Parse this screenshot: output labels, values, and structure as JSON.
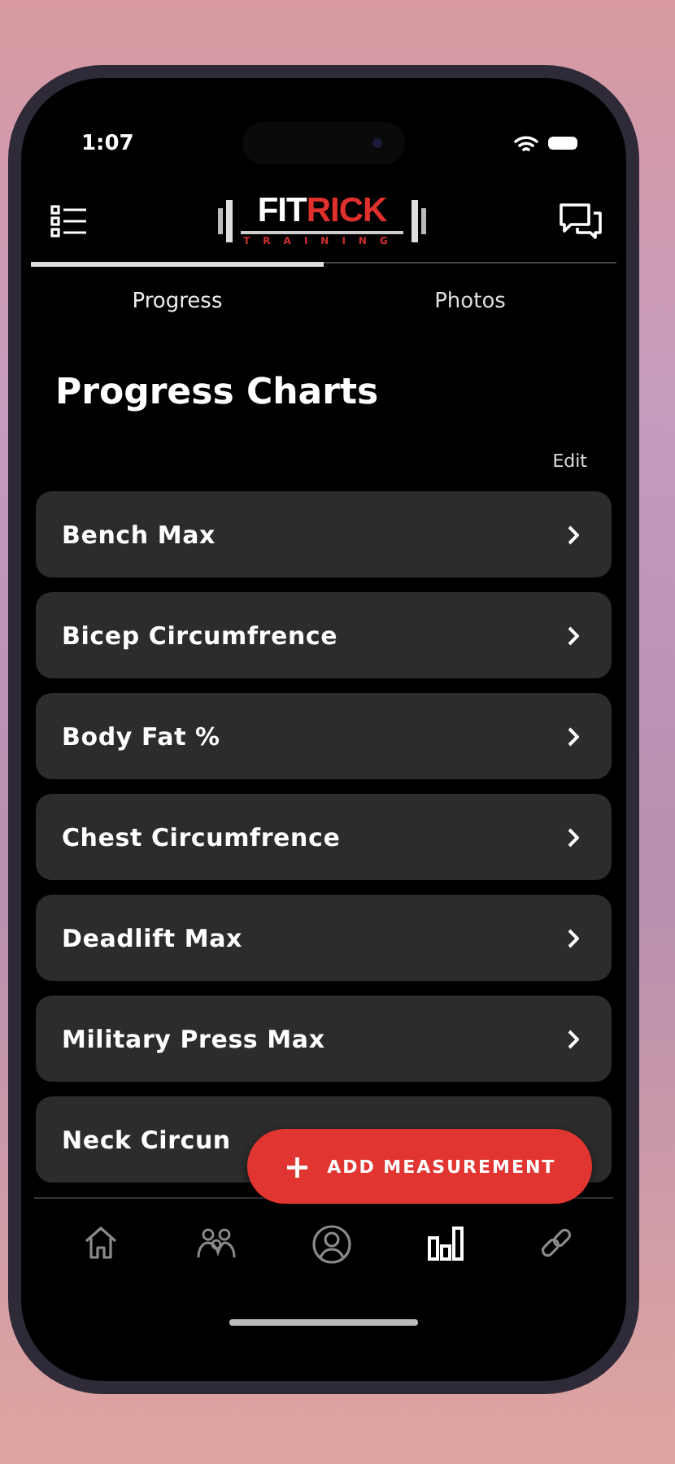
{
  "status_bar": {
    "time": "1:07"
  },
  "header": {
    "logo": {
      "part_1": "FIT",
      "part_2": "RICK",
      "subtitle": "TRAINING"
    }
  },
  "tabs": [
    {
      "label": "Progress",
      "selected": true
    },
    {
      "label": "Photos",
      "selected": false
    }
  ],
  "title": "Progress Charts",
  "edit_link": "Edit",
  "charts": [
    {
      "label": "Bench Max",
      "chevron": true
    },
    {
      "label": "Bicep Circumfrence",
      "chevron": true
    },
    {
      "label": "Body Fat %",
      "chevron": true
    },
    {
      "label": "Chest Circumfrence",
      "chevron": true
    },
    {
      "label": "Deadlift Max",
      "chevron": true
    },
    {
      "label": "Military Press Max",
      "chevron": true
    },
    {
      "label": "Neck Circun",
      "chevron": false
    }
  ],
  "fab": {
    "icon": "+",
    "label": "ADD MEASUREMENT"
  },
  "bottom_nav": [
    {
      "kind": "home",
      "selected": false
    },
    {
      "kind": "group",
      "selected": false
    },
    {
      "kind": "profile",
      "selected": false
    },
    {
      "kind": "chart",
      "selected": true
    },
    {
      "kind": "link",
      "selected": false
    }
  ]
}
